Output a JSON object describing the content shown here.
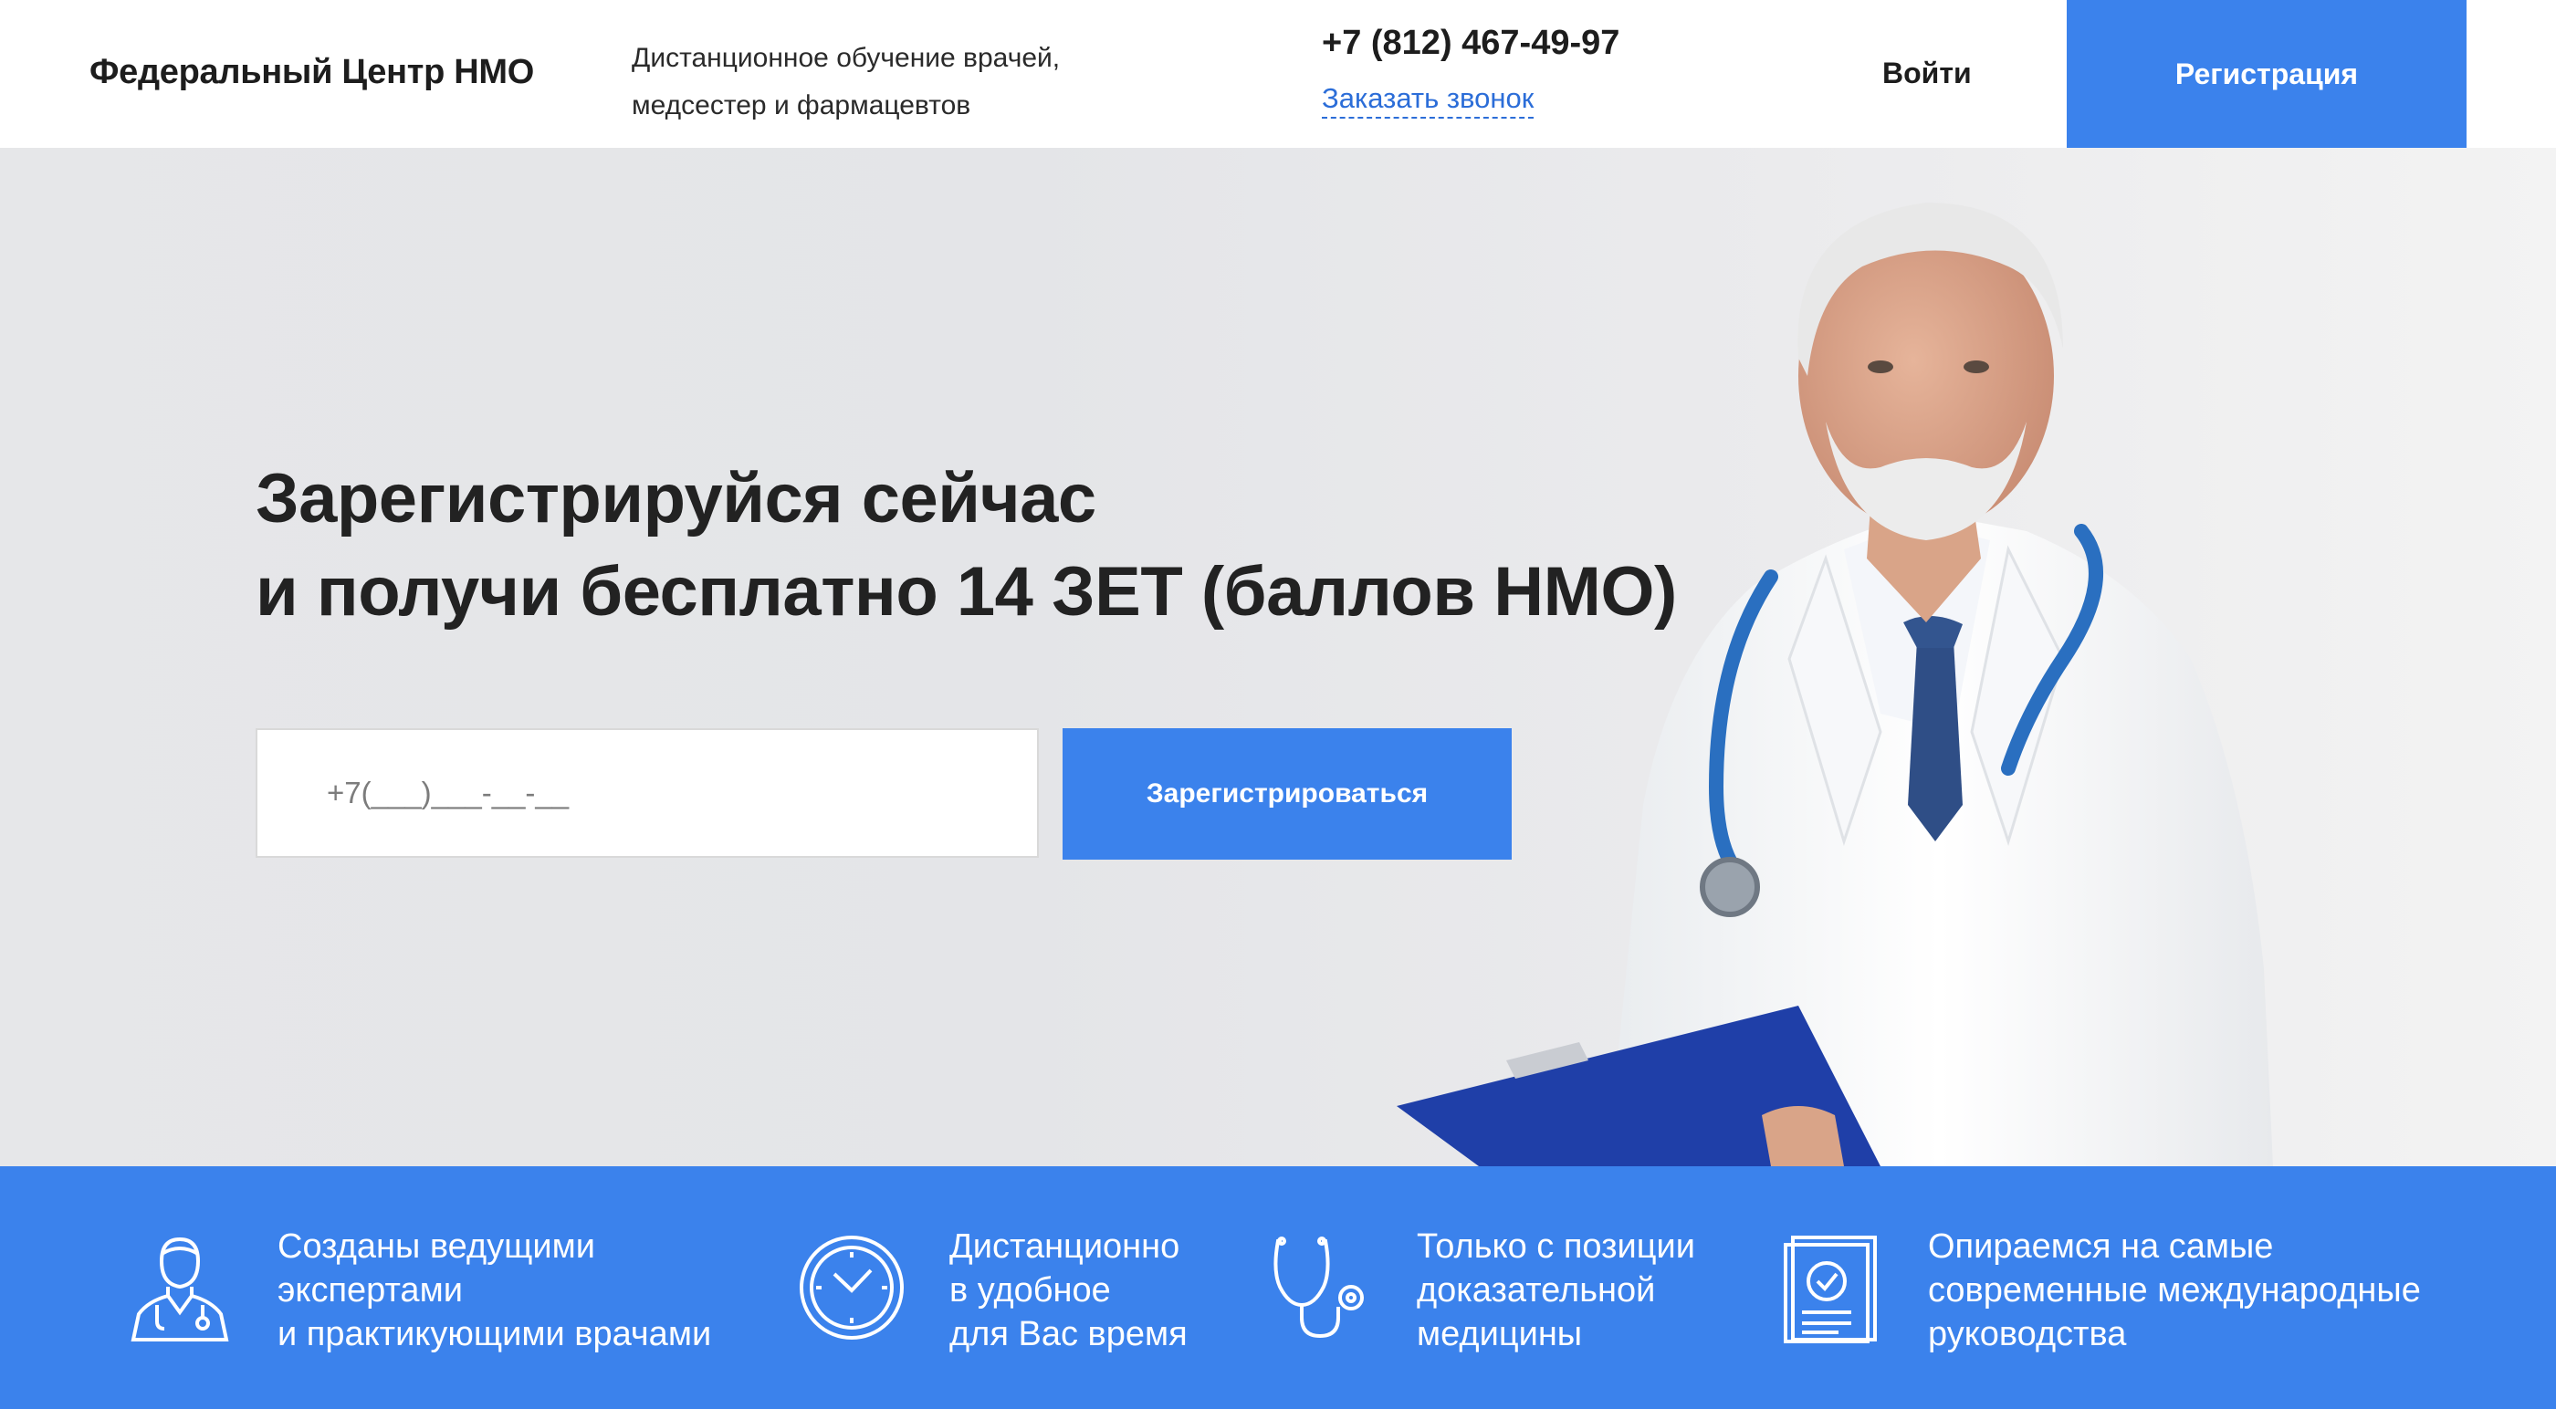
{
  "header": {
    "logo": "Федеральный Центр НМО",
    "tagline_line1": "Дистанционное обучение врачей,",
    "tagline_line2": "медсестер и фармацевтов",
    "phone": "+7 (812) 467-49-97",
    "callback": "Заказать звонок",
    "login": "Войти",
    "register": "Регистрация"
  },
  "hero": {
    "title_line1": "Зарегистрируйся сейчас",
    "title_line2": "и получи бесплатно 14 ЗЕТ (баллов НМО)",
    "phone_placeholder": "+7(___)___-__-__",
    "cta": "Зарегистрироваться"
  },
  "features": [
    {
      "icon": "doctor-icon",
      "lines": [
        "Созданы ведущими",
        "экспертами",
        "и практикующими врачами"
      ]
    },
    {
      "icon": "clock-icon",
      "lines": [
        "Дистанционно",
        "в удобное",
        "для Вас время"
      ]
    },
    {
      "icon": "stethoscope-icon",
      "lines": [
        "Только с позиции",
        "доказательной",
        "медицины"
      ]
    },
    {
      "icon": "document-check-icon",
      "lines": [
        "Опираемся на самые",
        "современные международные",
        "руководства"
      ]
    }
  ],
  "colors": {
    "accent": "#3b82ec",
    "link": "#2b6dd8"
  }
}
